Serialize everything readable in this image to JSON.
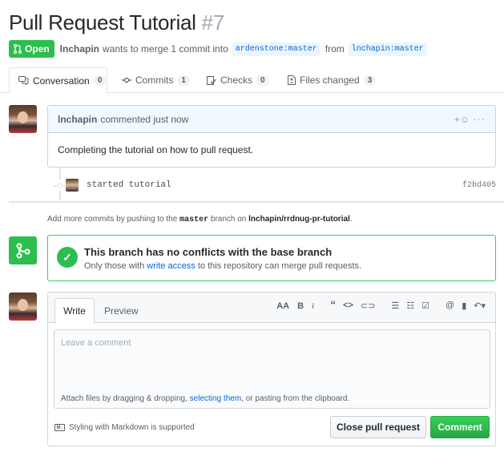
{
  "pr": {
    "title": "Pull Request Tutorial",
    "number": "#7",
    "state_label": "Open",
    "author": "lnchapin",
    "summary": "wants to merge 1 commit into",
    "base_ref": "ardenstone:master",
    "from_word": "from",
    "head_ref": "lnchapin:master"
  },
  "tabs": [
    {
      "label": "Conversation",
      "count": "0"
    },
    {
      "label": "Commits",
      "count": "1"
    },
    {
      "label": "Checks",
      "count": "0"
    },
    {
      "label": "Files changed",
      "count": "3"
    }
  ],
  "comment": {
    "author": "lnchapin",
    "time": "commented just now",
    "body": "Completing the tutorial on how to pull request.",
    "reaction_icon": "smiley-add-icon",
    "more_icon": "kebab-horizontal-icon"
  },
  "commit": {
    "message": "started tutorial",
    "sha": "f2bd405"
  },
  "hint": {
    "pre": "Add more commits by pushing to the",
    "branch": "master",
    "mid": "branch on",
    "repo": "lnchapin/rrdnug-pr-tutorial",
    "post": "."
  },
  "merge": {
    "heading": "This branch has no conflicts with the base branch",
    "sub_pre": "Only those with",
    "sub_link": "write access",
    "sub_post": "to this repository can merge pull requests."
  },
  "composer": {
    "tab_write": "Write",
    "tab_preview": "Preview",
    "placeholder": "Leave a comment",
    "attach_pre": "Attach files by dragging & dropping,",
    "attach_link": "selecting them",
    "attach_post": ", or pasting from the clipboard.",
    "markdown_note": "Styling with Markdown is supported",
    "close_button": "Close pull request",
    "comment_button": "Comment"
  },
  "colors": {
    "green": "#2cbe4e",
    "link": "#0366d6",
    "comment_header": "#f1f8ff"
  }
}
